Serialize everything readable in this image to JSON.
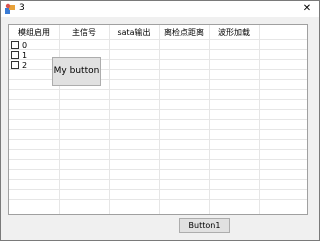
{
  "window": {
    "title": "3",
    "close_glyph": "✕",
    "app_icon": "app-icon"
  },
  "grid": {
    "columns": [
      "模组启用",
      "主信号",
      "sata输出",
      "离检点距离",
      "波形加载"
    ],
    "checkboxes": [
      {
        "label": "0",
        "checked": false
      },
      {
        "label": "1",
        "checked": false
      },
      {
        "label": "2",
        "checked": false
      }
    ]
  },
  "my_button": {
    "label": "My button"
  },
  "footer": {
    "button1_label": "Button1"
  }
}
